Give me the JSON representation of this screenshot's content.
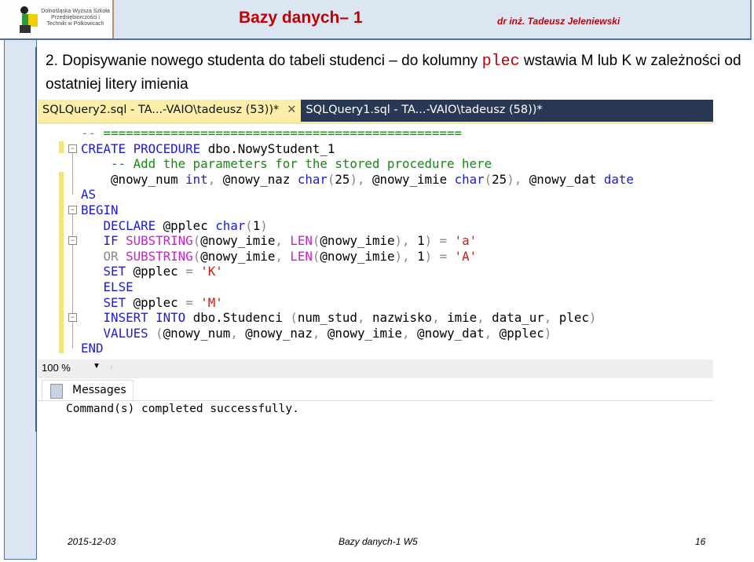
{
  "header": {
    "logo_text": "Dolnośląska Wyższa Szkoła Przedsiębiorczości i Techniki w Polkowicach",
    "title": "Bazy danych– 1",
    "author": "dr inż. Tadeusz Jeleniewski"
  },
  "heading": {
    "part1": "2. Dopisywanie nowego studenta do tabeli studenci – do kolumny ",
    "code": "plec",
    "part2": " wstawia M lub K w zależności od ostatniej litery imienia"
  },
  "ssms": {
    "tabs": [
      {
        "label": "SQLQuery2.sql - TA...-VAIO\\tadeusz (53))*",
        "active": true,
        "close": "✕"
      },
      {
        "label": "SQLQuery1.sql - TA...-VAIO\\tadeusz (58))*",
        "active": false
      }
    ],
    "code": [
      "-- ================================================",
      "CREATE PROCEDURE dbo.NowyStudent_1",
      "    -- Add the parameters for the stored procedure here",
      "    @nowy_num int, @nowy_naz char(25), @nowy_imie char(25), @nowy_dat date",
      "AS",
      "BEGIN",
      "   DECLARE @pplec char(1)",
      "   IF SUBSTRING(@nowy_imie, LEN(@nowy_imie), 1) = 'a'",
      "   OR SUBSTRING(@nowy_imie, LEN(@nowy_imie), 1) = 'A'",
      "   SET @pplec = 'K'",
      "   ELSE",
      "   SET @pplec = 'M'",
      "   INSERT INTO dbo.Studenci (num_stud, nazwisko, imie, data_ur, plec)",
      "   VALUES (@nowy_num, @nowy_naz, @nowy_imie, @nowy_dat, @pplec)",
      "END"
    ],
    "zoom": "100 %",
    "messages_tab": "Messages",
    "message": "Command(s) completed successfully."
  },
  "footer": {
    "date": "2015-12-03",
    "center": "Bazy danych-1 W5",
    "page": "16"
  },
  "colors": {
    "title": "#c00000",
    "keyword": "#1a1ad8",
    "comment": "#148a14",
    "string": "#cc1a1a",
    "function": "#d01ad0",
    "tabbar": "#293955"
  }
}
